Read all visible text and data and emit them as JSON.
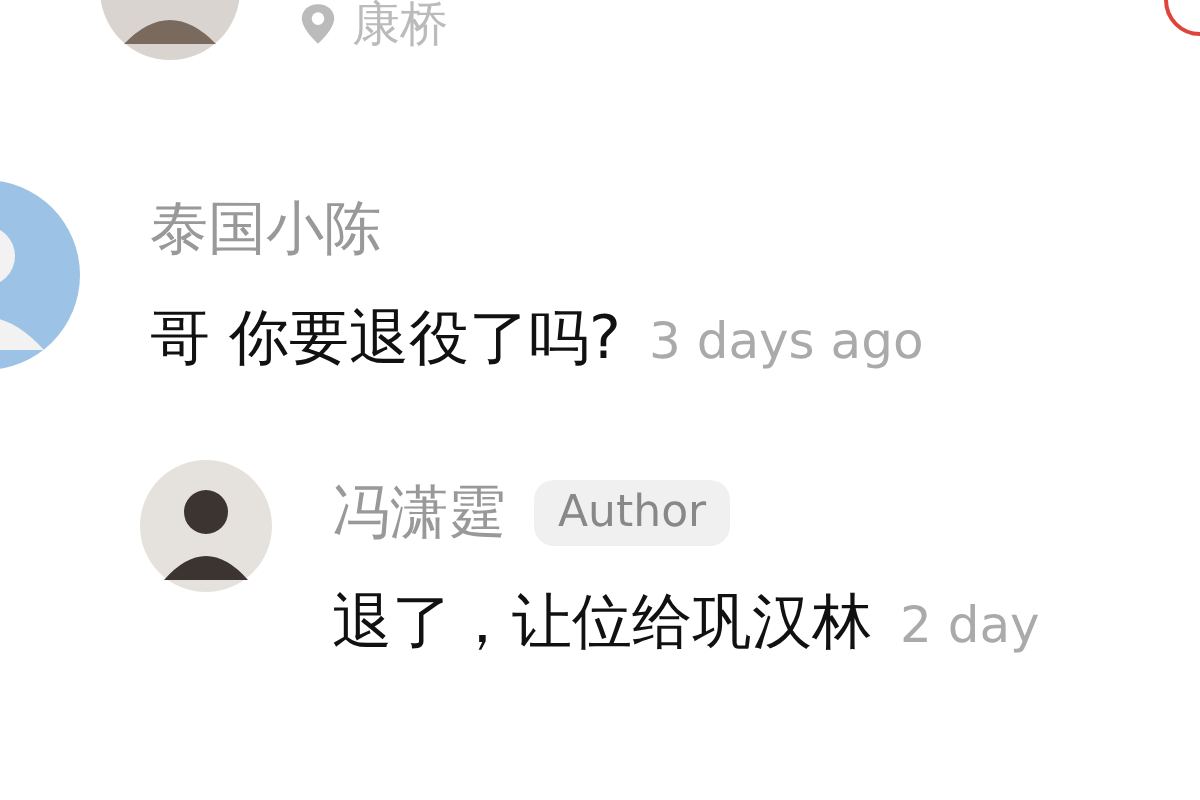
{
  "top": {
    "location": "康桥"
  },
  "comment": {
    "name": "泰国小陈",
    "text": "哥 你要退役了吗?",
    "time": "3 days ago"
  },
  "reply": {
    "name": "冯潇霆",
    "badge": "Author",
    "text": "退了，让位给巩汉林",
    "time": "2 day"
  }
}
